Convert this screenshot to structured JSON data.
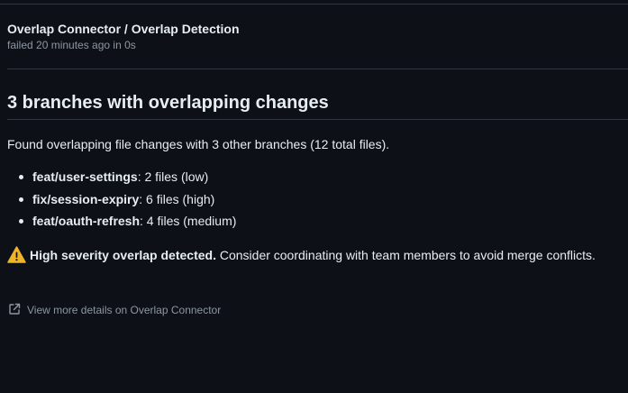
{
  "check": {
    "title": "Overlap Connector / Overlap Detection",
    "status_line": "failed 20 minutes ago in 0s"
  },
  "summary": {
    "heading": "3 branches with overlapping changes",
    "intro": "Found overlapping file changes with 3 other branches (12 total files).",
    "branches": [
      {
        "name": "feat/user-settings",
        "detail": ": 2 files (low)"
      },
      {
        "name": "fix/session-expiry",
        "detail": ": 6 files (high)"
      },
      {
        "name": "feat/oauth-refresh",
        "detail": ": 4 files (medium)"
      }
    ],
    "warning": {
      "icon": "warning-icon",
      "strong": "High severity overlap detected.",
      "text": " Consider coordinating with team members to avoid merge conflicts."
    }
  },
  "footer": {
    "details_link": "View more details on Overlap Connector",
    "icon": "external-link-icon"
  },
  "colors": {
    "background": "#0d1117",
    "text": "#e6edf3",
    "muted": "#8d96a0",
    "border": "#30363d",
    "warning": "#f0b429"
  }
}
